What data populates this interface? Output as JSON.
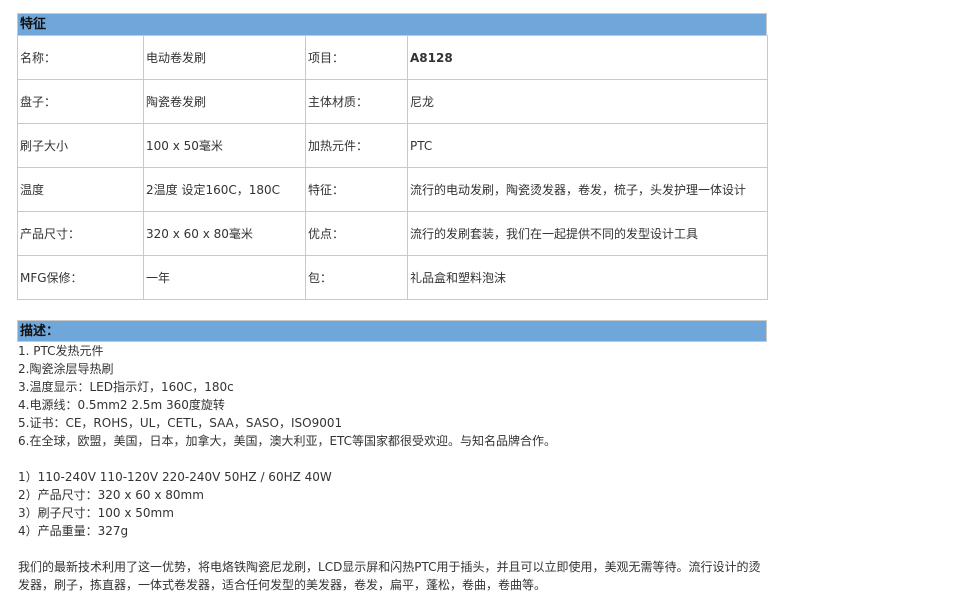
{
  "features": {
    "title": "特征",
    "rows": [
      {
        "label1": "名称：",
        "value1": "电动卷发刷",
        "label2": "项目：",
        "value2": "A8128"
      },
      {
        "label1": "盘子：",
        "value1": "陶瓷卷发刷",
        "label2": "主体材质：",
        "value2": "尼龙"
      },
      {
        "label1": "刷子大小",
        "value1": "100 x 50毫米",
        "label2": "加热元件：",
        "value2": "PTC"
      },
      {
        "label1": "温度",
        "value1": "2温度 设定160C，180C",
        "label2": "特征：",
        "value2": "流行的电动发刷，陶瓷烫发器，卷发，梳子，头发护理一体设计"
      },
      {
        "label1": "产品尺寸：",
        "value1": "320 x 60 x 80毫米",
        "label2": "优点：",
        "value2": "流行的发刷套装，我们在一起提供不同的发型设计工具"
      },
      {
        "label1": "MFG保修：",
        "value1": "一年",
        "label2": "包：",
        "value2": "礼品盒和塑料泡沫"
      }
    ]
  },
  "description": {
    "title": "描述：",
    "list1": [
      "1. PTC发热元件",
      "2.陶瓷涂层导热刷",
      "3.温度显示：LED指示灯，160C，180c",
      "4.电源线：0.5mm2 2.5m 360度旋转",
      "5.证书：CE，ROHS，UL，CETL，SAA，SASO，ISO9001",
      "6.在全球，欧盟，美国，日本，加拿大，美国，澳大利亚，ETC等国家都很受欢迎。与知名品牌合作。"
    ],
    "list2": [
      "1）110-240V 110-120V 220-240V 50HZ / 60HZ 40W",
      "2）产品尺寸：320 x 60 x 80mm",
      "3）刷子尺寸：100 x 50mm",
      "4）产品重量：327g"
    ],
    "paragraph": "我们的最新技术利用了这一优势，将电烙铁陶瓷尼龙刷，LCD显示屏和闪热PTC用于插头，并且可以立即使用，美观无需等待。流行设计的烫发器，刷子，拣直器，一体式卷发器，适合任何发型的美发器，卷发，扁平，蓬松，卷曲，卷曲等。"
  }
}
